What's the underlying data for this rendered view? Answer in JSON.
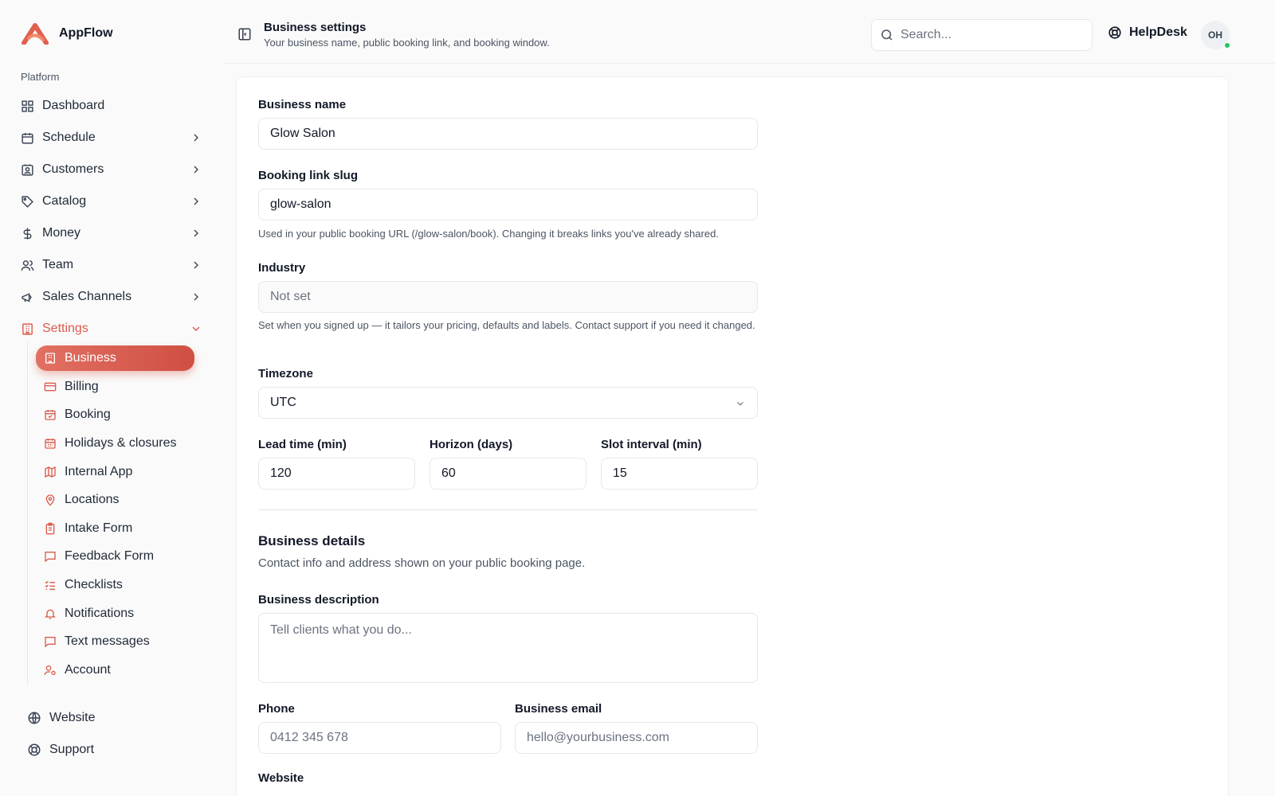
{
  "brand": {
    "name": "AppFlow",
    "accent": "#dc5a4c"
  },
  "sidebar": {
    "group_label": "Platform",
    "items": [
      {
        "label": "Dashboard",
        "icon": "grid-icon",
        "expandable": false
      },
      {
        "label": "Schedule",
        "icon": "calendar-icon",
        "expandable": true
      },
      {
        "label": "Customers",
        "icon": "contact-icon",
        "expandable": true
      },
      {
        "label": "Catalog",
        "icon": "tag-icon",
        "expandable": true
      },
      {
        "label": "Money",
        "icon": "dollar-icon",
        "expandable": true
      },
      {
        "label": "Team",
        "icon": "users-icon",
        "expandable": true
      },
      {
        "label": "Sales Channels",
        "icon": "megaphone-icon",
        "expandable": true
      },
      {
        "label": "Settings",
        "icon": "building-icon",
        "expandable": true,
        "active": true
      }
    ],
    "settings_items": [
      {
        "label": "Business",
        "icon": "building-icon",
        "active": true
      },
      {
        "label": "Billing",
        "icon": "credit-card-icon"
      },
      {
        "label": "Booking",
        "icon": "calendar-check-icon"
      },
      {
        "label": "Holidays & closures",
        "icon": "calendar-icon"
      },
      {
        "label": "Internal App",
        "icon": "map-icon"
      },
      {
        "label": "Locations",
        "icon": "map-pin-icon"
      },
      {
        "label": "Intake Form",
        "icon": "clipboard-icon"
      },
      {
        "label": "Feedback Form",
        "icon": "message-square-icon"
      },
      {
        "label": "Checklists",
        "icon": "list-checks-icon"
      },
      {
        "label": "Notifications",
        "icon": "bell-icon"
      },
      {
        "label": "Text messages",
        "icon": "message-square-icon"
      },
      {
        "label": "Account",
        "icon": "user-cog-icon"
      }
    ],
    "footer_items": [
      {
        "label": "Website",
        "icon": "globe-icon"
      },
      {
        "label": "Support",
        "icon": "lifebuoy-icon"
      }
    ]
  },
  "header": {
    "title": "Business settings",
    "subtitle": "Your business name, public booking link, and booking window.",
    "search_placeholder": "Search...",
    "helpdesk_label": "HelpDesk",
    "avatar_initials": "OH"
  },
  "form": {
    "business_name": {
      "label": "Business name",
      "value": "Glow Salon"
    },
    "slug": {
      "label": "Booking link slug",
      "value": "glow-salon",
      "help": "Used in your public booking URL (/glow-salon/book). Changing it breaks links you've already shared."
    },
    "industry": {
      "label": "Industry",
      "value": "Not set",
      "help": "Set when you signed up — it tailors your pricing, defaults and labels. Contact support if you need it changed."
    },
    "timezone": {
      "label": "Timezone",
      "value": "UTC"
    },
    "lead_time": {
      "label": "Lead time (min)",
      "value": "120"
    },
    "horizon": {
      "label": "Horizon (days)",
      "value": "60"
    },
    "slot_interval": {
      "label": "Slot interval (min)",
      "value": "15"
    },
    "details": {
      "title": "Business details",
      "subtitle": "Contact info and address shown on your public booking page."
    },
    "description": {
      "label": "Business description",
      "placeholder": "Tell clients what you do..."
    },
    "phone": {
      "label": "Phone",
      "placeholder": "0412 345 678"
    },
    "email": {
      "label": "Business email",
      "placeholder": "hello@yourbusiness.com"
    },
    "website": {
      "label": "Website"
    }
  }
}
